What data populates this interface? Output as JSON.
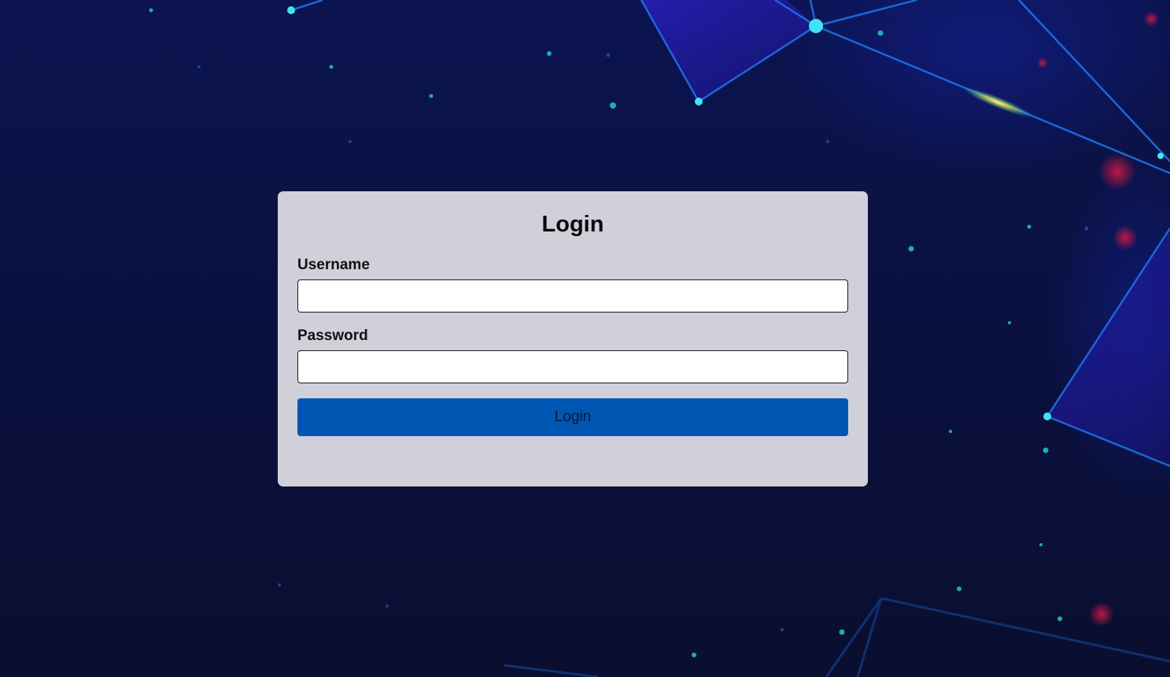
{
  "login_form": {
    "title": "Login",
    "username_label": "Username",
    "username_value": "",
    "password_label": "Password",
    "password_value": "",
    "submit_label": "Login"
  },
  "colors": {
    "background": "#0a1140",
    "card_background": "#d0d0da",
    "button_background": "#0057b3",
    "network_lines": "#1e6fe6",
    "network_nodes": "#3fe4f0",
    "red_orbs": "#c0193c"
  }
}
